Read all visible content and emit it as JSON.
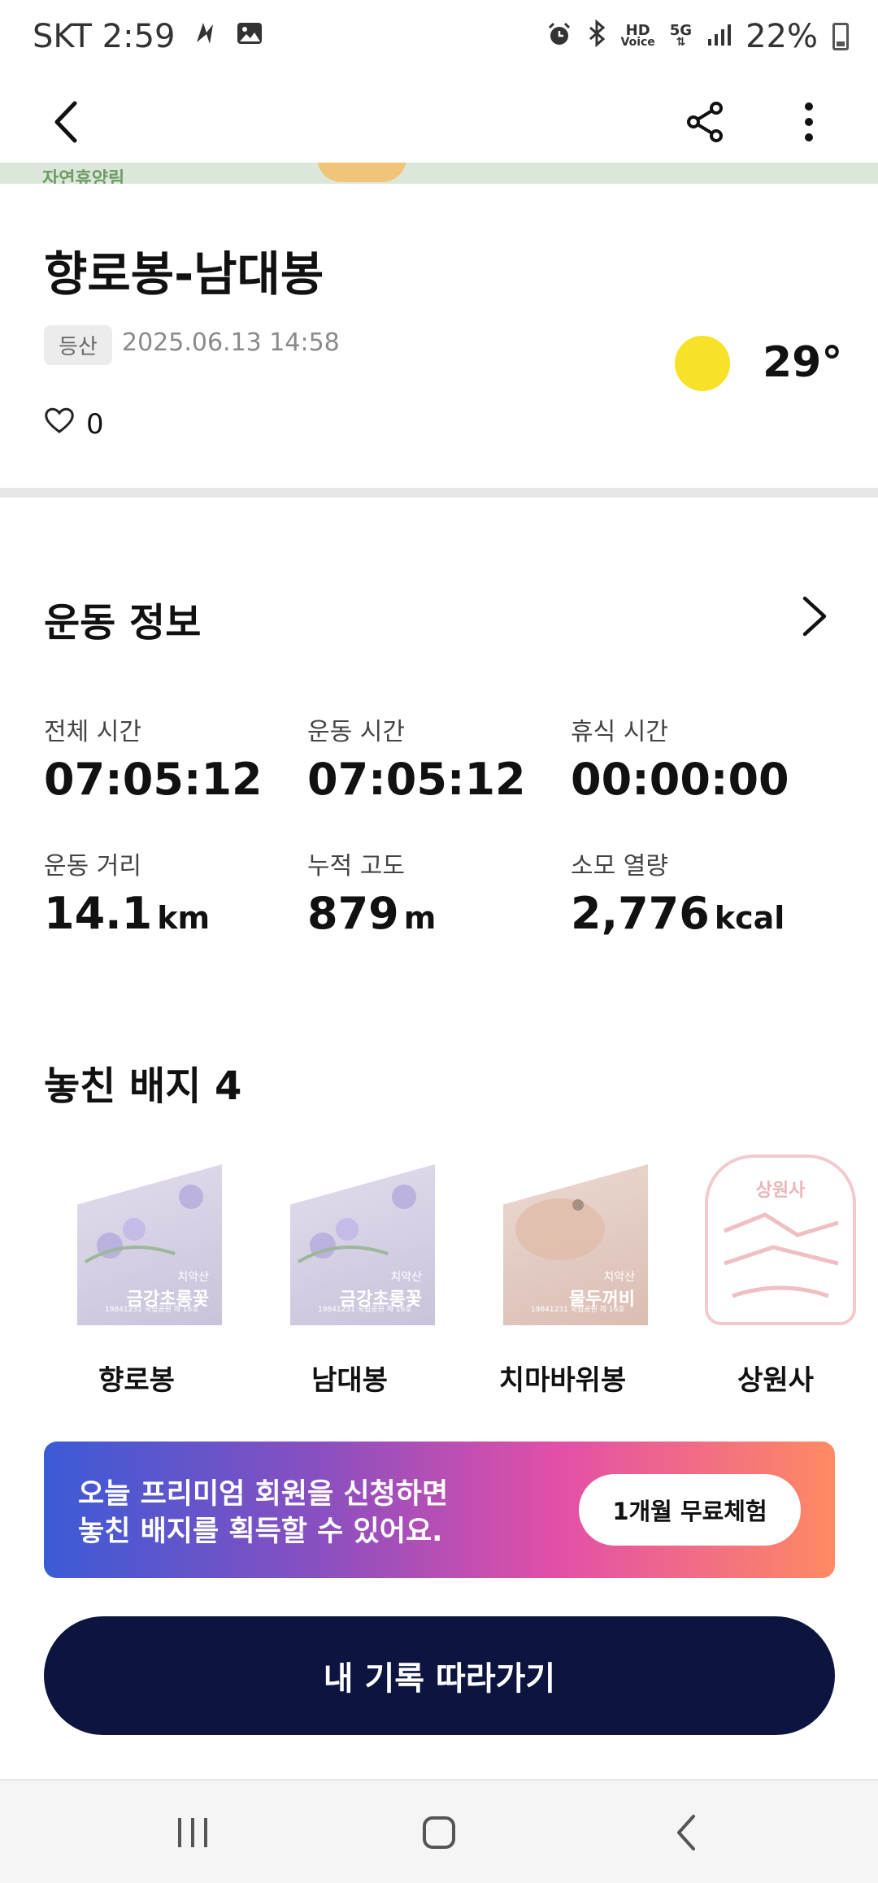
{
  "status_bar": {
    "carrier_time": "SKT 2:59",
    "battery_percent": "22%",
    "icons": [
      "lightning-crossed-icon",
      "gallery-icon",
      "alarm-icon",
      "bluetooth-icon",
      "hd-voice-icon",
      "5g-icon",
      "signal-icon",
      "battery-icon"
    ],
    "hd_voice_top": "HD",
    "hd_voice_bottom": "Voice",
    "net_label": "5G"
  },
  "app_bar": {
    "icons": [
      "back-arrow-icon",
      "share-icon",
      "more-vert-icon"
    ]
  },
  "map": {
    "partial_label": "자연휴양림"
  },
  "record": {
    "title": "향로봉-남대봉",
    "tag": "등산",
    "datetime": "2025.06.13 14:58",
    "likes": "0",
    "weather_icon": "sun-icon",
    "temperature": "29°"
  },
  "exercise": {
    "section_title": "운동 정보",
    "stats": [
      {
        "label": "전체 시간",
        "value": "07:05:12",
        "unit": ""
      },
      {
        "label": "운동 시간",
        "value": "07:05:12",
        "unit": ""
      },
      {
        "label": "휴식 시간",
        "value": "00:00:00",
        "unit": ""
      },
      {
        "label": "운동 거리",
        "value": "14.1",
        "unit": "km"
      },
      {
        "label": "누적 고도",
        "value": "879",
        "unit": "m"
      },
      {
        "label": "소모 열량",
        "value": "2,776",
        "unit": "kcal"
      }
    ]
  },
  "badges": {
    "section_title": "놓친 배지 4",
    "items": [
      {
        "name": "향로봉",
        "card_sub": "치악산",
        "card_name": "금강초롱꽃",
        "card_foot": "19841231 국립공원 제 16호"
      },
      {
        "name": "남대봉",
        "card_sub": "치악산",
        "card_name": "금강초롱꽃",
        "card_foot": "19841231 국립공원 제 16호"
      },
      {
        "name": "치마바위봉",
        "card_sub": "치악산",
        "card_name": "물두꺼비",
        "card_foot": "19841231 국립공원 제 16호"
      },
      {
        "name": "상원사",
        "card_sub": "",
        "card_name": "상원사",
        "card_foot": ""
      }
    ]
  },
  "premium_banner": {
    "line1": "오늘 프리미엄 회원을 신청하면",
    "line2": "놓친 배지를 획득할 수 있어요.",
    "button": "1개월 무료체험"
  },
  "follow_button": "내 기록 따라가기",
  "nav_bar": {
    "icons": [
      "recents-icon",
      "home-icon",
      "back-icon"
    ]
  },
  "colors": {
    "primary_dark": "#0d1440",
    "sun": "#f7e228",
    "banner_start": "#3a5bd6",
    "banner_end": "#ff8a62"
  }
}
